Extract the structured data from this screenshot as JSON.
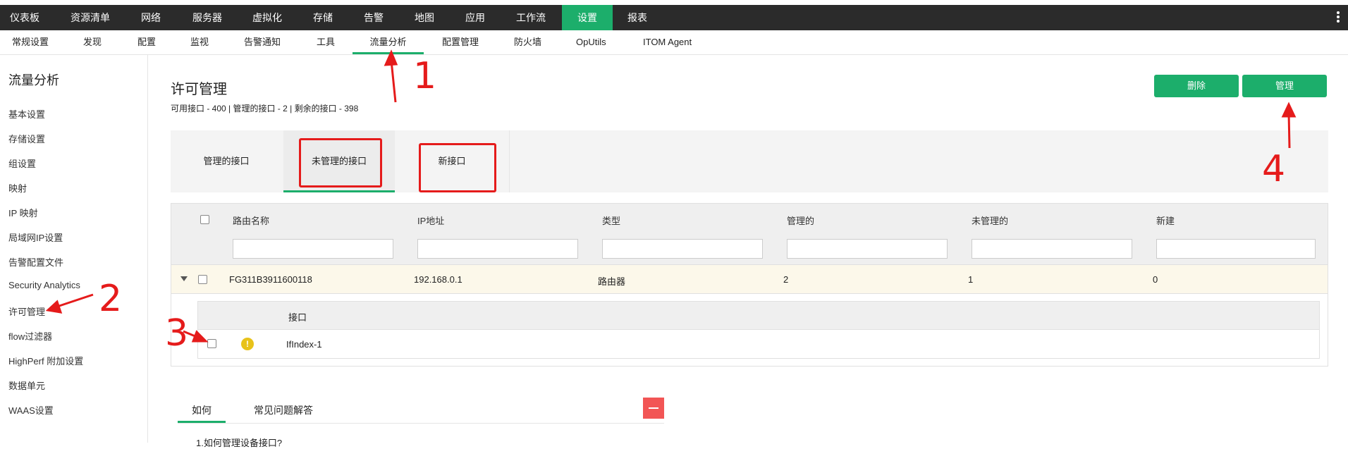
{
  "top_nav": [
    {
      "label": "仪表板",
      "active": false
    },
    {
      "label": "资源清单",
      "active": false
    },
    {
      "label": "网络",
      "active": false
    },
    {
      "label": "服务器",
      "active": false
    },
    {
      "label": "虚拟化",
      "active": false
    },
    {
      "label": "存储",
      "active": false
    },
    {
      "label": "告警",
      "active": false
    },
    {
      "label": "地图",
      "active": false
    },
    {
      "label": "应用",
      "active": false
    },
    {
      "label": "工作流",
      "active": false
    },
    {
      "label": "设置",
      "active": true
    },
    {
      "label": "报表",
      "active": false
    }
  ],
  "sub_nav": [
    {
      "label": "常规设置"
    },
    {
      "label": "发现"
    },
    {
      "label": "配置"
    },
    {
      "label": "监视"
    },
    {
      "label": "告警通知"
    },
    {
      "label": "工具"
    },
    {
      "label": "流量分析",
      "active": true
    },
    {
      "label": "配置管理"
    },
    {
      "label": "防火墙"
    },
    {
      "label": "OpUtils"
    },
    {
      "label": "ITOM Agent"
    }
  ],
  "sidebar": {
    "title": "流量分析",
    "items": [
      "基本设置",
      "存储设置",
      "组设置",
      "映射",
      "IP 映射",
      "局域网IP设置",
      "告警配置文件",
      "Security Analytics",
      "许可管理",
      "flow过滤器",
      "HighPerf 附加设置",
      "数据单元",
      "WAAS设置"
    ]
  },
  "page": {
    "title": "许可管理",
    "stats": "可用接口 - 400 | 管理的接口 - 2 | 剩余的接口 - 398",
    "delete_label": "删除",
    "manage_label": "管理"
  },
  "tabs": [
    {
      "label": "管理的接口"
    },
    {
      "label": "未管理的接口",
      "active": true
    },
    {
      "label": "新接口"
    }
  ],
  "table": {
    "columns": [
      "路由名称",
      "IP地址",
      "类型",
      "管理的",
      "未管理的",
      "新建"
    ],
    "rows": [
      {
        "name": "FG311B3911600118",
        "ip": "192.168.0.1",
        "type": "路由器",
        "managed": "2",
        "unmanaged": "1",
        "new": "0"
      }
    ],
    "sub_header": "接口",
    "sub_rows": [
      {
        "interface": "IfIndex-1",
        "status_icon": "warning-icon"
      }
    ]
  },
  "help": {
    "tabs": [
      "如何",
      "常见问题解答"
    ],
    "first_line": "1.如何管理设备接口?"
  },
  "annotations": [
    "1",
    "2",
    "3",
    "4"
  ],
  "colors": {
    "accent": "#1cae6b",
    "topbar": "#2b2b2b",
    "annotation": "#e51b1b",
    "collapse": "#f25555",
    "row_highlight": "#fcf8ea"
  }
}
